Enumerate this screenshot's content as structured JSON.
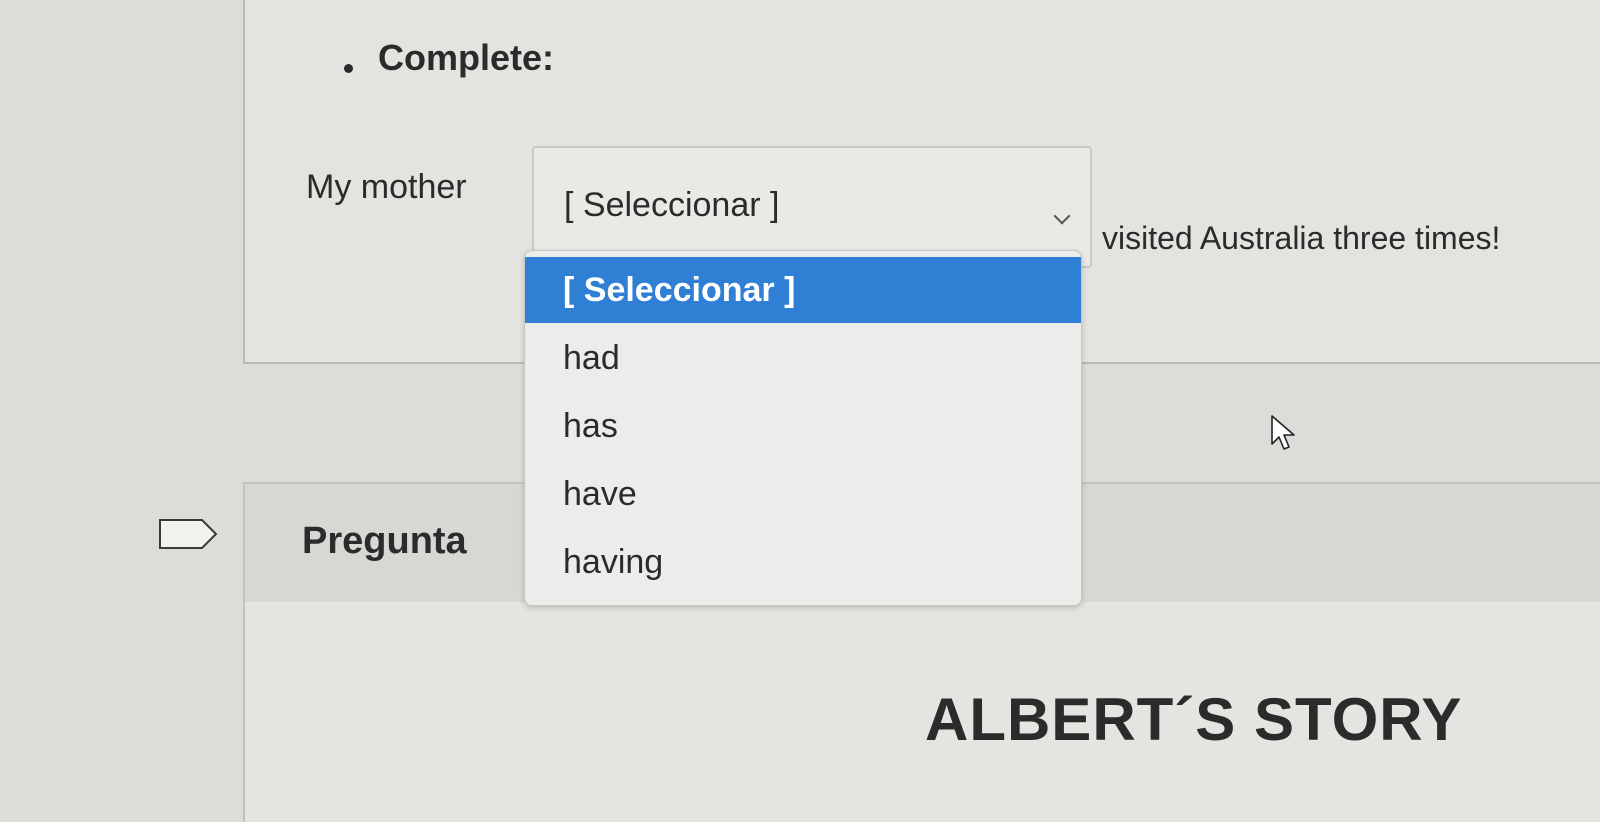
{
  "question": {
    "instruction": "Complete:",
    "sentence_before": "My mother",
    "sentence_after": "visited Australia three times!",
    "select": {
      "current_value": "[ Seleccionar ]",
      "options": [
        "[ Seleccionar ]",
        "had",
        "has",
        "have",
        "having"
      ],
      "highlighted_option": "[ Seleccionar ]"
    }
  },
  "next_question": {
    "label": "Pregunta"
  },
  "story": {
    "title": "ALBERT´S STORY"
  },
  "colors": {
    "highlight": "#2f7fd4",
    "highlight_text": "#ffffff",
    "background": "#dcdcd8",
    "text": "#2b2b2b"
  }
}
